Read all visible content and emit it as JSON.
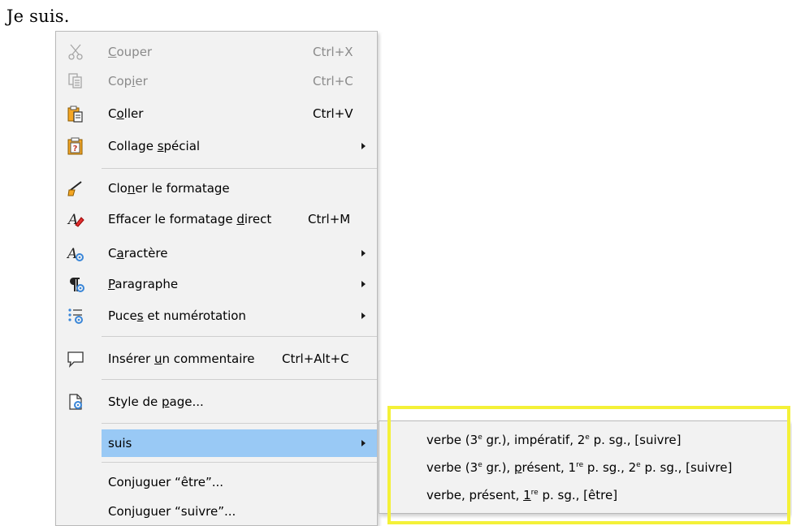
{
  "document": {
    "text": "Je suis."
  },
  "context_menu": {
    "cut": {
      "pre": "",
      "acc": "C",
      "post": "ouper",
      "shortcut": "Ctrl+X",
      "icon": "scissors-icon"
    },
    "copy": {
      "pre": "Cop",
      "acc": "i",
      "post": "er",
      "shortcut": "Ctrl+C",
      "icon": "copy-icon"
    },
    "paste": {
      "pre": "C",
      "acc": "o",
      "post": "ller",
      "shortcut": "Ctrl+V",
      "icon": "paste-icon"
    },
    "paste_special": {
      "pre": "Collage ",
      "acc": "s",
      "post": "pécial",
      "icon": "paste-special-icon"
    },
    "clone": {
      "pre": "Clo",
      "acc": "n",
      "post": "er le formatage",
      "icon": "clone-formatting-icon"
    },
    "clear": {
      "pre": "Effacer le formatage ",
      "acc": "d",
      "post": "irect",
      "shortcut": "Ctrl+M",
      "icon": "clear-formatting-icon"
    },
    "character": {
      "pre": "C",
      "acc": "a",
      "post": "ractère",
      "icon": "character-icon"
    },
    "paragraph": {
      "pre": "",
      "acc": "P",
      "post": "aragraphe",
      "icon": "paragraph-icon"
    },
    "bullets": {
      "pre": "Puce",
      "acc": "s",
      "post": " et numérotation",
      "icon": "bullets-icon"
    },
    "comment": {
      "pre": "Insérer ",
      "acc": "u",
      "post": "n commentaire",
      "shortcut": "Ctrl+Alt+C",
      "icon": "comment-icon"
    },
    "page_style": {
      "pre": "Style de ",
      "acc": "p",
      "post": "age...",
      "icon": "page-style-icon"
    },
    "suis": "suis",
    "conj_etre": "Conjuguer “être”...",
    "conj_suivre": "Conjuguer “suivre”..."
  },
  "submenu": {
    "item1": {
      "a": "verbe (3",
      "b": "e",
      "c": " gr.), impératif, 2",
      "d": "e",
      "e": " p. sg., [suivre]"
    },
    "item2": {
      "a": "verbe (3",
      "b": "e",
      "c": " gr.), ",
      "acc": "p",
      "c2": "résent, 1",
      "d": "re",
      "e": " p. sg., 2",
      "f": "e",
      "g": " p. sg., [suivre]"
    },
    "item3": {
      "a": "verbe, présent, ",
      "acc": "1",
      "d": "re",
      "e": " p. sg., [être]"
    }
  },
  "colors": {
    "highlight": "#99c9f5",
    "frame": "#f4f138",
    "menu_bg": "#f2f2f2"
  }
}
